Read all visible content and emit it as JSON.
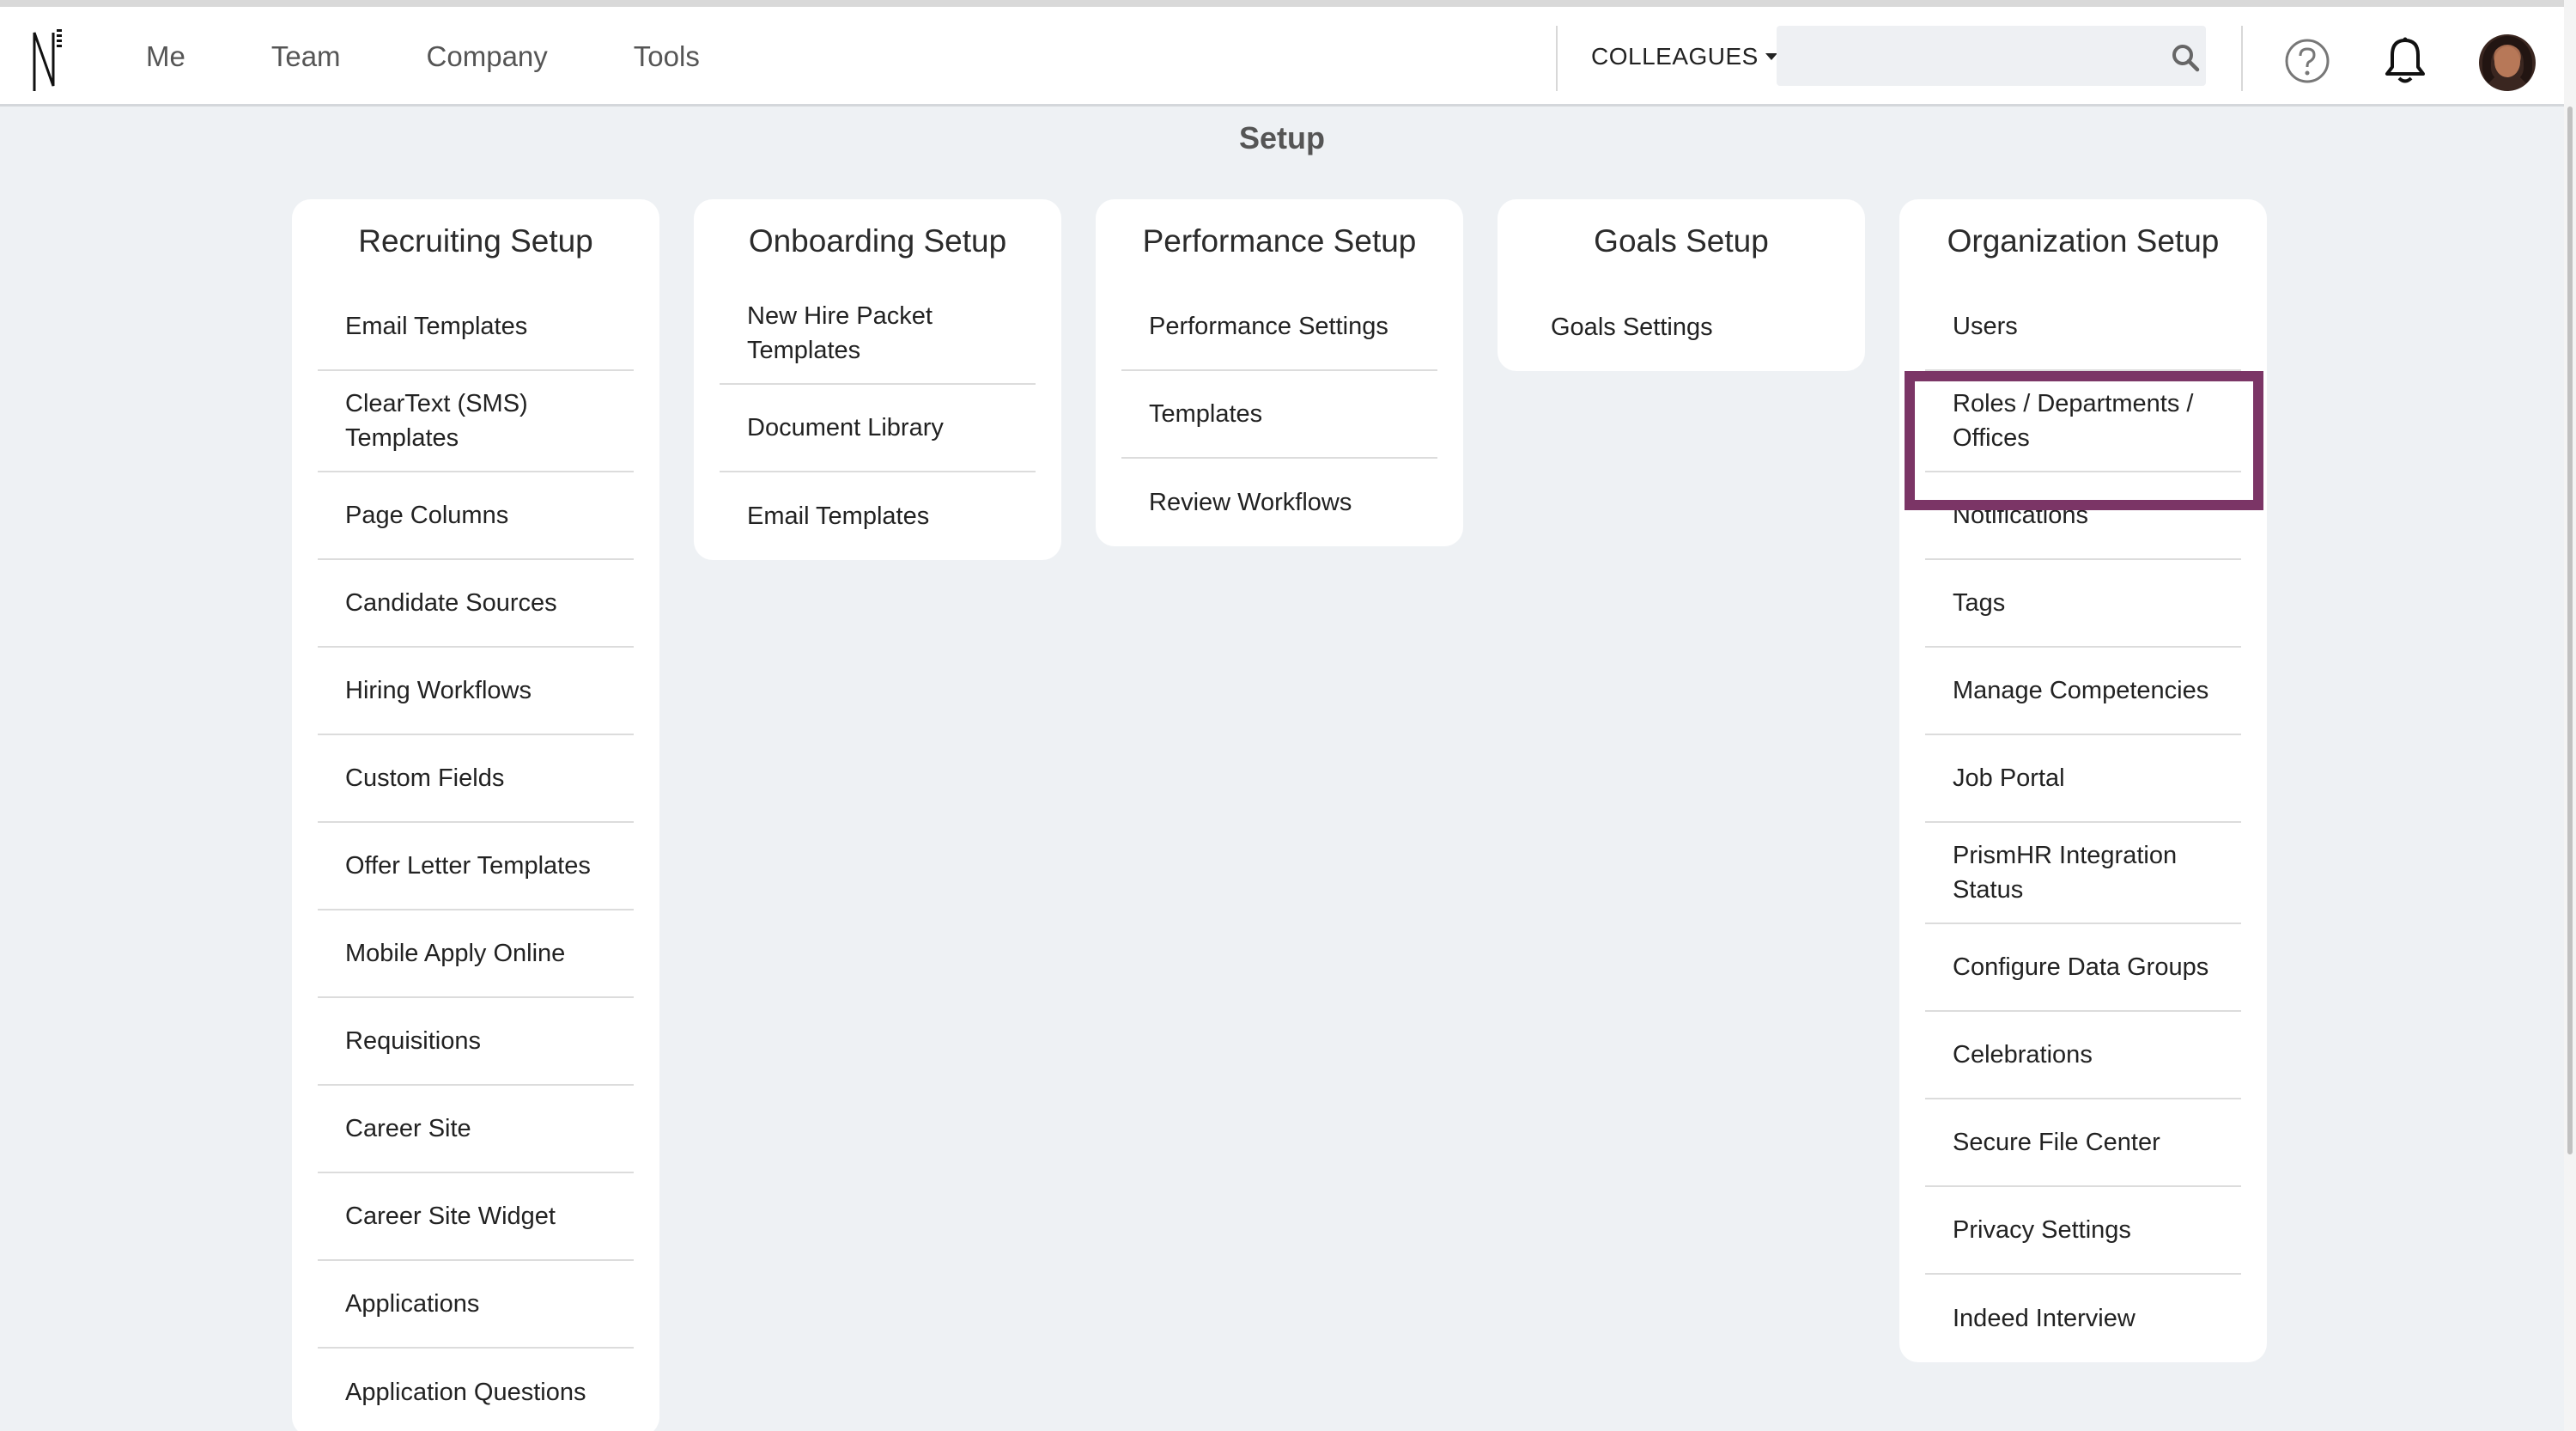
{
  "nav": {
    "items": [
      "Me",
      "Team",
      "Company",
      "Tools"
    ],
    "colleagues_label": "COLLEAGUES",
    "search_value": ""
  },
  "page": {
    "title": "Setup"
  },
  "colors": {
    "highlight": "#7b3566",
    "background": "#eef1f4"
  },
  "icons": [
    "logo-icon",
    "search-icon",
    "help-icon",
    "bell-icon",
    "avatar"
  ],
  "cards": [
    {
      "title": "Recruiting Setup",
      "items": [
        "Email Templates",
        "ClearText (SMS) Templates",
        "Page Columns",
        "Candidate Sources",
        "Hiring Workflows",
        "Custom Fields",
        "Offer Letter Templates",
        "Mobile Apply Online",
        "Requisitions",
        "Career Site",
        "Career Site Widget",
        "Applications",
        "Application Questions"
      ]
    },
    {
      "title": "Onboarding Setup",
      "items": [
        "New Hire Packet Templates",
        "Document Library",
        "Email Templates"
      ]
    },
    {
      "title": "Performance Setup",
      "items": [
        "Performance Settings",
        "Templates",
        "Review Workflows"
      ]
    },
    {
      "title": "Goals Setup",
      "items": [
        "Goals Settings"
      ]
    },
    {
      "title": "Organization Setup",
      "items": [
        "Users",
        "Roles / Departments / Offices",
        "Notifications",
        "Tags",
        "Manage Competencies",
        "Job Portal",
        "PrismHR Integration Status",
        "Configure Data Groups",
        "Celebrations",
        "Secure File Center",
        "Privacy Settings",
        "Indeed Interview"
      ]
    }
  ]
}
